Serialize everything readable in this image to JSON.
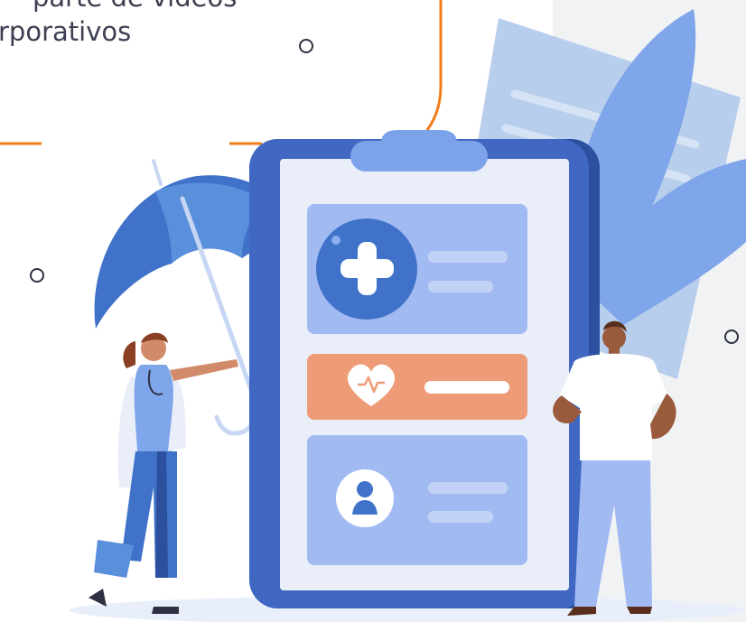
{
  "caption": {
    "line1": "parte de vídeos",
    "line2": "rporativos"
  },
  "illustration": {
    "subject": "health-insurance-clipboard-illustration",
    "clipboard_cards": [
      {
        "icon": "plus-cross-icon"
      },
      {
        "icon": "heart-pulse-icon"
      },
      {
        "icon": "user-profile-icon"
      }
    ],
    "figures": [
      "doctor-with-umbrella",
      "man-hands-on-hips"
    ]
  },
  "colors": {
    "accent_orange": "#F07D19",
    "clipboard_blue": "#4068C3",
    "card_blue": "#A2BAF2",
    "card_orange": "#EE9B77",
    "paper_blue": "#B7CEEC",
    "leaf_blue": "#7FA6EA",
    "text": "#3D3F52"
  }
}
